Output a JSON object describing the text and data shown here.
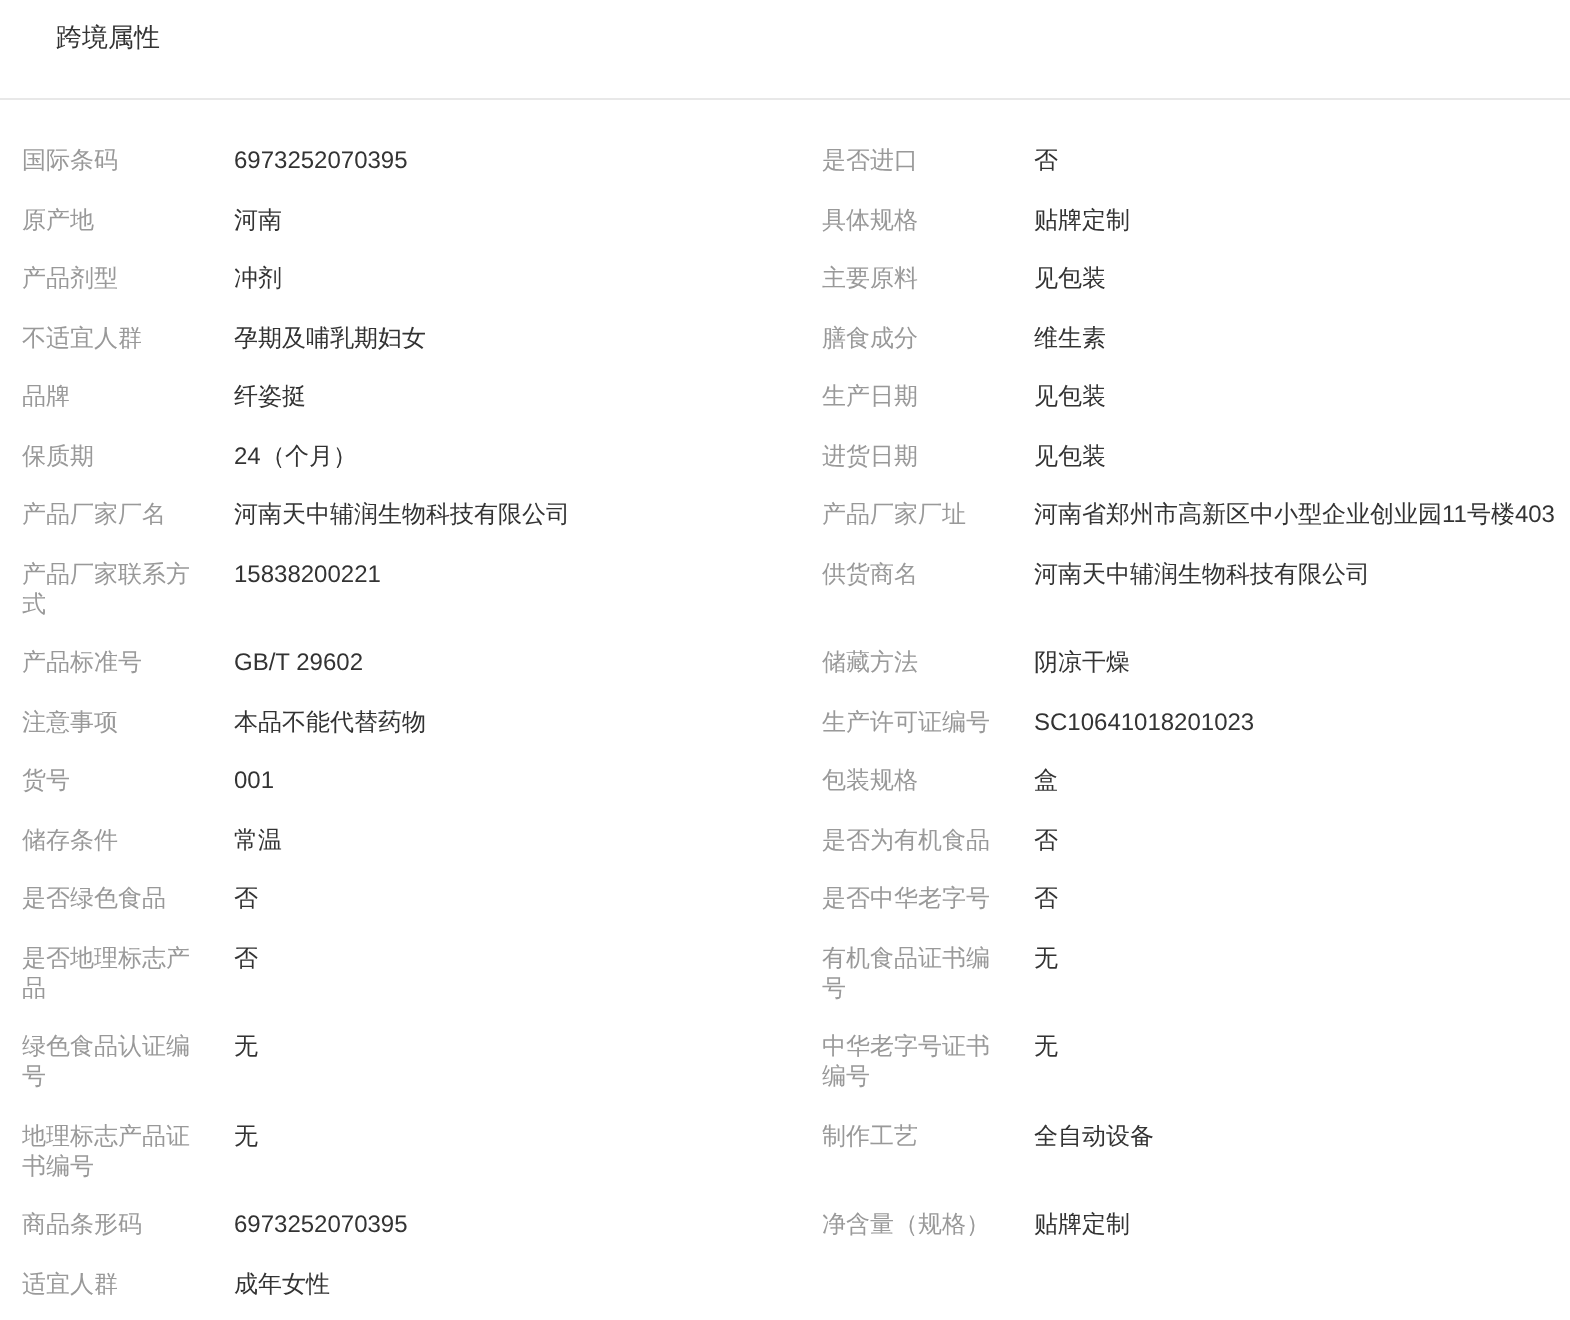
{
  "title": "跨境属性",
  "properties": [
    {
      "label": "国际条码",
      "value": "6973252070395"
    },
    {
      "label": "是否进口",
      "value": "否"
    },
    {
      "label": "原产地",
      "value": "河南"
    },
    {
      "label": "具体规格",
      "value": "贴牌定制"
    },
    {
      "label": "产品剂型",
      "value": "冲剂"
    },
    {
      "label": "主要原料",
      "value": "见包装"
    },
    {
      "label": "不适宜人群",
      "value": "孕期及哺乳期妇女"
    },
    {
      "label": "膳食成分",
      "value": "维生素"
    },
    {
      "label": "品牌",
      "value": "纤姿挺"
    },
    {
      "label": "生产日期",
      "value": "见包装"
    },
    {
      "label": "保质期",
      "value": "24（个月）"
    },
    {
      "label": "进货日期",
      "value": "见包装"
    },
    {
      "label": "产品厂家厂名",
      "value": "河南天中辅润生物科技有限公司"
    },
    {
      "label": "产品厂家厂址",
      "value": "河南省郑州市高新区中小型企业创业园11号楼403"
    },
    {
      "label": "产品厂家联系方式",
      "value": "15838200221"
    },
    {
      "label": "供货商名",
      "value": "河南天中辅润生物科技有限公司"
    },
    {
      "label": "产品标准号",
      "value": "GB/T 29602"
    },
    {
      "label": "储藏方法",
      "value": "阴凉干燥"
    },
    {
      "label": "注意事项",
      "value": "本品不能代替药物"
    },
    {
      "label": "生产许可证编号",
      "value": "SC10641018201023"
    },
    {
      "label": "货号",
      "value": "001"
    },
    {
      "label": "包装规格",
      "value": "盒"
    },
    {
      "label": "储存条件",
      "value": "常温"
    },
    {
      "label": "是否为有机食品",
      "value": "否"
    },
    {
      "label": "是否绿色食品",
      "value": "否"
    },
    {
      "label": "是否中华老字号",
      "value": "否"
    },
    {
      "label": "是否地理标志产品",
      "value": "否"
    },
    {
      "label": "有机食品证书编号",
      "value": "无"
    },
    {
      "label": "绿色食品认证编号",
      "value": "无"
    },
    {
      "label": "中华老字号证书编号",
      "value": "无"
    },
    {
      "label": "地理标志产品证书编号",
      "value": "无"
    },
    {
      "label": "制作工艺",
      "value": "全自动设备"
    },
    {
      "label": "商品条形码",
      "value": "6973252070395"
    },
    {
      "label": "净含量（规格）",
      "value": "贴牌定制"
    },
    {
      "label": "适宜人群",
      "value": "成年女性"
    }
  ]
}
